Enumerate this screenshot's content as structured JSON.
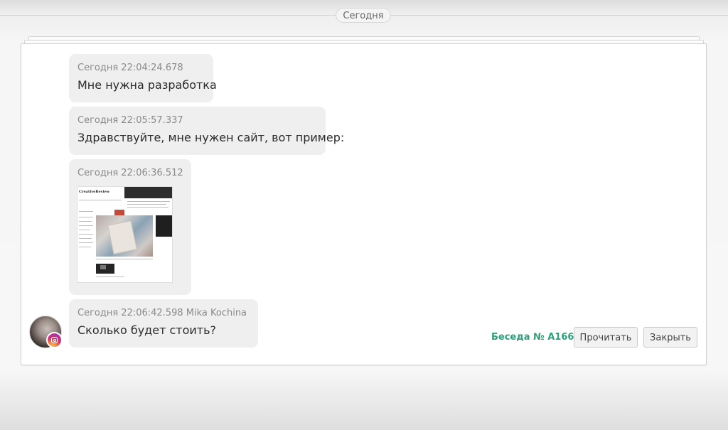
{
  "date_divider": {
    "label": "Сегодня"
  },
  "messages": [
    {
      "meta": "Сегодня 22:04:24.678",
      "text": "Мне нужна разработка"
    },
    {
      "meta": "Сегодня 22:05:57.337",
      "text": "Здравствуйте, мне нужен сайт, вот пример:"
    },
    {
      "meta": "Сегодня 22:06:36.512",
      "image_logo_text": "CreativeReview"
    },
    {
      "meta": "Сегодня 22:06:42.598 Mika Kochina",
      "text": "Сколько будет стоить?",
      "avatar_badge_icon": "instagram-icon"
    }
  ],
  "footer": {
    "conversation_label": "Беседа № A166",
    "read_button": "Прочитать",
    "close_button": "Закрыть"
  },
  "colors": {
    "accent": "#2f9e7a",
    "bubble": "#efefef"
  }
}
